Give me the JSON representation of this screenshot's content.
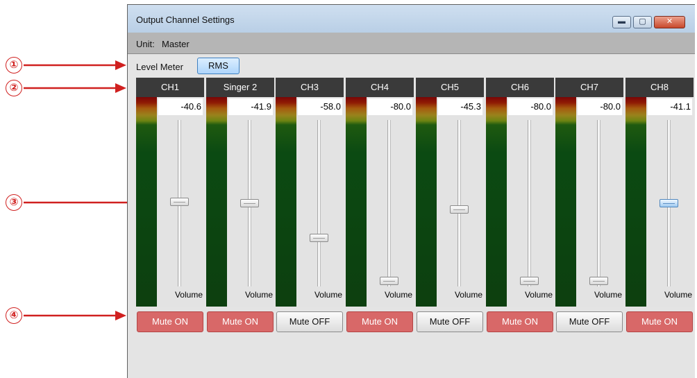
{
  "window": {
    "title": "Output Channel Settings"
  },
  "unit": {
    "label": "Unit:",
    "value": "Master"
  },
  "level_meter": {
    "label": "Level Meter",
    "mode": "RMS"
  },
  "window_controls": {
    "minimize": "▬",
    "maximize": "▢",
    "close": "✕"
  },
  "callouts": [
    "①",
    "②",
    "③",
    "④"
  ],
  "colors": {
    "callout": "#d0201f",
    "mute_on": "#d86868",
    "header": "#3a3a3a",
    "selected": "#aed5fb"
  },
  "channels": [
    {
      "name": "CH1",
      "level": "-40.6",
      "fader_fraction": 0.5,
      "volume_label": "Volume",
      "mute": "Mute ON",
      "mute_on": true,
      "selected": false
    },
    {
      "name": "Singer 2",
      "level": "-41.9",
      "fader_fraction": 0.49,
      "volume_label": "Volume",
      "mute": "Mute ON",
      "mute_on": true,
      "selected": false
    },
    {
      "name": "CH3",
      "level": "-58.0",
      "fader_fraction": 0.27,
      "volume_label": "Volume",
      "mute": "Mute OFF",
      "mute_on": false,
      "selected": false
    },
    {
      "name": "CH4",
      "level": "-80.0",
      "fader_fraction": 0.0,
      "volume_label": "Volume",
      "mute": "Mute ON",
      "mute_on": true,
      "selected": false
    },
    {
      "name": "CH5",
      "level": "-45.3",
      "fader_fraction": 0.45,
      "volume_label": "Volume",
      "mute": "Mute OFF",
      "mute_on": false,
      "selected": false
    },
    {
      "name": "CH6",
      "level": "-80.0",
      "fader_fraction": 0.0,
      "volume_label": "Volume",
      "mute": "Mute ON",
      "mute_on": true,
      "selected": false
    },
    {
      "name": "CH7",
      "level": "-80.0",
      "fader_fraction": 0.0,
      "volume_label": "Volume",
      "mute": "Mute OFF",
      "mute_on": false,
      "selected": false
    },
    {
      "name": "CH8",
      "level": "-41.1",
      "fader_fraction": 0.49,
      "volume_label": "Volume",
      "mute": "Mute ON",
      "mute_on": true,
      "selected": true
    }
  ]
}
